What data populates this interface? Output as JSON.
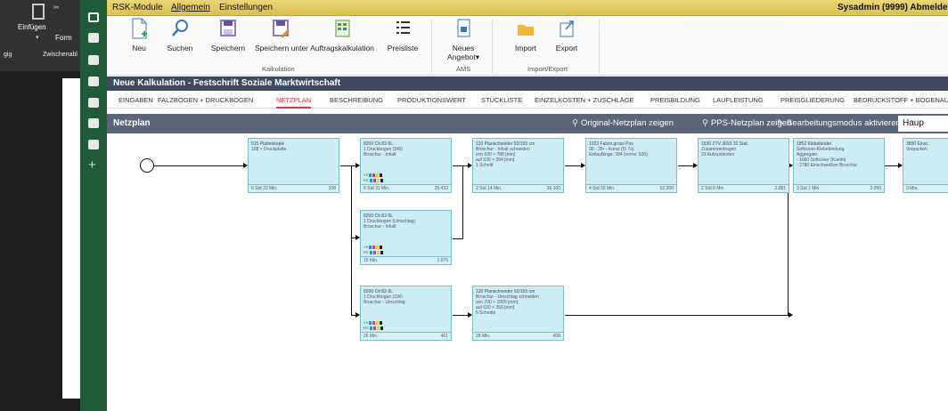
{
  "left_app": {
    "paste": "Einfügen",
    "clipboard": "Zwischenabl",
    "format": "Form",
    "edge": "gig"
  },
  "menubar": {
    "items": [
      "RSK-Module",
      "Allgemein",
      "Einstellungen"
    ],
    "user": "Sysadmin (9999) Abmelde"
  },
  "ribbon": {
    "buttons": [
      {
        "label": "Neu",
        "icon": "new-document-icon"
      },
      {
        "label": "Suchen",
        "icon": "search-icon"
      },
      {
        "label": "Speichern",
        "icon": "save-icon"
      },
      {
        "label": "Speichern unter",
        "icon": "save-as-icon"
      },
      {
        "label": "Auftragskalkulation",
        "icon": "calculation-icon"
      },
      {
        "label": "Preisliste",
        "icon": "list-icon"
      },
      {
        "label": "Neues Angebot▾",
        "icon": "offer-icon"
      },
      {
        "label": "Import",
        "icon": "import-folder-icon"
      },
      {
        "label": "Export",
        "icon": "export-icon"
      }
    ],
    "groups": [
      "Kalkulation",
      "AMS",
      "Import/Export"
    ]
  },
  "document_title": "Neue Kalkulation - Festschrift Soziale Marktwirtschaft",
  "tabs": [
    "EINGABEN",
    "FALZBOGEN + DRUCKBOGEN",
    "NETZPLAN",
    "BESCHREIBUNG",
    "PRODUKTIONSWERT",
    "STÜCKLISTE",
    "EINZELKOSTEN + ZUSCHLÄGE",
    "PREISBILDUNG",
    "LAUFLEISTUNG",
    "PREISGLIEDERUNG",
    "BEDRUCKSTOFF + BOGENAUF"
  ],
  "active_tab": "NETZPLAN",
  "netzplan": {
    "title": "Netzplan",
    "actions": [
      "Original-Netzplan zeigen",
      "PPS-Netzplan zeigen",
      "Bearbeitungsmodus aktivieren"
    ],
    "haupt": "Haup"
  },
  "nodes": [
    {
      "head": "515 Plattenkopie",
      "l1": "108 × Druckplatte",
      "l2": "",
      "l3": "",
      "l4": "",
      "cmyk": false,
      "foot_l": "6 Std 23 Min.",
      "foot_r": "108"
    },
    {
      "head": "8200 Ctt 82-5L",
      "l1": "1 Druckbogen (SW)",
      "l2": "Broschur - Inhalt",
      "l3": "",
      "l4": "",
      "cmyk": true,
      "foot_l": "6 Std 31 Min.",
      "foot_r": "25.432"
    },
    {
      "head": "120 Planschneider 92/155 cm",
      "l1": "Broschur - Inhalt schneiden",
      "l2": "von 630 × 788 [mm]",
      "l3": "auf 630 × 394 [mm]",
      "l4": "1 Schnitt",
      "cmyk": false,
      "foot_l": "2 Std 14 Min.",
      "foot_r": "26.100"
    },
    {
      "head": "1022 Falzm.gross Pos",
      "l1": "30 - 28r - Kreuz (f3 7a)",
      "l2": "Einlaufänge: 394 (vorne: 630)",
      "l3": "",
      "l4": "",
      "cmyk": false,
      "foot_l": "4 Std 55 Min.",
      "foot_r": "52.200"
    },
    {
      "head": "1530 ZTV 3693 32 Stat.",
      "l1": "Zusammentragen",
      "l2": "23 Aufzuständen",
      "l3": "",
      "l4": "",
      "cmyk": false,
      "foot_l": "2 Std 8 Min.",
      "foot_r": "2.081"
    },
    {
      "head": "1852 Klebebinder",
      "l1": "Softcover-Klebebindung",
      "l2": "Aggregate:",
      "l3": "- 1660 Softcover (Kombi)",
      "l4": "- 2780 Einschweißen Broschur",
      "cmyk": false,
      "foot_l": "3 Std 1 Min.",
      "foot_r": "2.050"
    },
    {
      "head": "3890 Einsc",
      "l1": "Verpacken",
      "l2": "",
      "l3": "",
      "l4": "",
      "cmyk": false,
      "foot_l": "3 Min.",
      "foot_r": ""
    },
    {
      "head": "8200 Ctt 82-5L",
      "l1": "1 Druckbogen (Umschlag)",
      "l2": "Broschur - Inhalt",
      "l3": "",
      "l4": "",
      "cmyk": true,
      "foot_l": "15 Min.",
      "foot_r": "1.075"
    },
    {
      "head": "8200 Ctt 82-5L",
      "l1": "1 Druckbogen (SW)",
      "l2": "Broschur - Umschlag",
      "l3": "",
      "l4": "",
      "cmyk": true,
      "foot_l": "26 Min.",
      "foot_r": "461"
    },
    {
      "head": "120 Planschneider 92/155 cm",
      "l1": "Broschur - Umschlag schneiden",
      "l2": "von 700 × 1000 [mm]",
      "l3": "auf 630 × 350 [mm]",
      "l4": "6 Schnitte",
      "cmyk": false,
      "foot_l": "28 Min.",
      "foot_r": "408"
    }
  ],
  "cmyk_labels": [
    "VS",
    "RS"
  ],
  "colors": {
    "rail": "#1f5b36",
    "menubar": "#dcc050",
    "doc_header": "#3d4a5e",
    "netzplan_header": "#5a6578",
    "node_fill": "#ccedf3",
    "active_tab": "#e0344a"
  }
}
